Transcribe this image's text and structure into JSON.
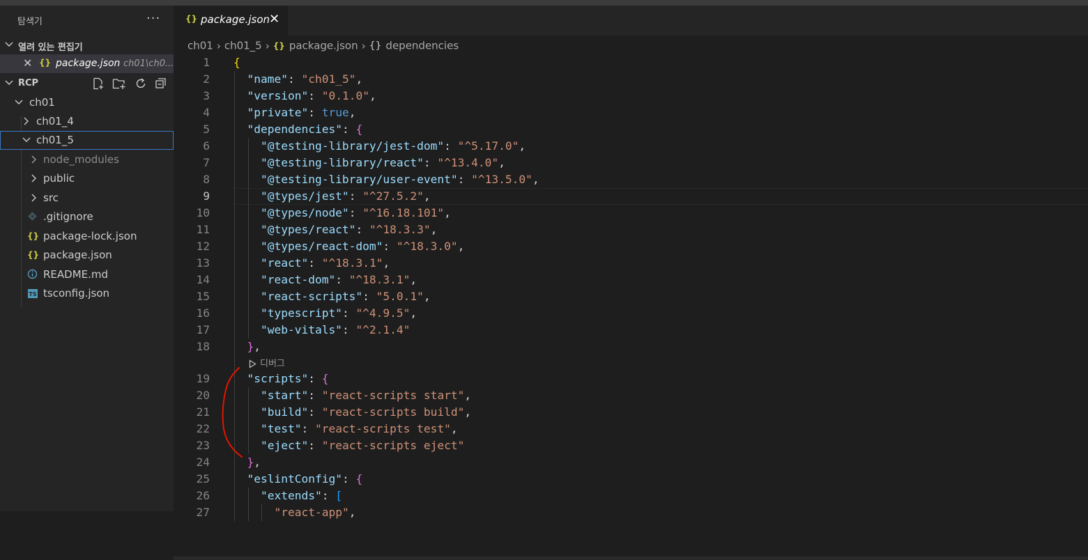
{
  "explorer": {
    "title": "탐색기",
    "more_label": "···",
    "open_editors": {
      "label": "열려 있는 편집기",
      "items": [
        {
          "icon": "{}",
          "name": "package.json",
          "path": "ch01\\ch0..."
        }
      ]
    },
    "workspace": {
      "label": "RCP",
      "tree": [
        {
          "label": "ch01",
          "type": "folder",
          "expanded": true
        },
        {
          "label": "ch01_4",
          "type": "folder",
          "expanded": false
        },
        {
          "label": "ch01_5",
          "type": "folder",
          "expanded": true,
          "selected": true
        },
        {
          "label": "node_modules",
          "type": "folder",
          "expanded": false
        },
        {
          "label": "public",
          "type": "folder",
          "expanded": false
        },
        {
          "label": "src",
          "type": "folder",
          "expanded": false
        },
        {
          "label": ".gitignore",
          "type": "file",
          "icon": "git-icon"
        },
        {
          "label": "package-lock.json",
          "type": "file",
          "icon": "{}"
        },
        {
          "label": "package.json",
          "type": "file",
          "icon": "{}"
        },
        {
          "label": "README.md",
          "type": "file",
          "icon": "info-icon"
        },
        {
          "label": "tsconfig.json",
          "type": "file",
          "icon": "TS"
        }
      ]
    }
  },
  "editor": {
    "tab": {
      "icon": "{}",
      "name": "package.json",
      "close": "✕"
    },
    "breadcrumb": [
      "ch01",
      "ch01_5",
      "package.json",
      "dependencies"
    ],
    "codelens_label": "디버그",
    "active_line": 9,
    "lines": [
      "{",
      "  \"name\": \"ch01_5\",",
      "  \"version\": \"0.1.0\",",
      "  \"private\": true,",
      "  \"dependencies\": {",
      "    \"@testing-library/jest-dom\": \"^5.17.0\",",
      "    \"@testing-library/react\": \"^13.4.0\",",
      "    \"@testing-library/user-event\": \"^13.5.0\",",
      "    \"@types/jest\": \"^27.5.2\",",
      "    \"@types/node\": \"^16.18.101\",",
      "    \"@types/react\": \"^18.3.3\",",
      "    \"@types/react-dom\": \"^18.3.0\",",
      "    \"react\": \"^18.3.1\",",
      "    \"react-dom\": \"^18.3.1\",",
      "    \"react-scripts\": \"5.0.1\",",
      "    \"typescript\": \"^4.9.5\",",
      "    \"web-vitals\": \"^2.1.4\"",
      "  },",
      "  \"scripts\": {",
      "    \"start\": \"react-scripts start\",",
      "    \"build\": \"react-scripts build\",",
      "    \"test\": \"react-scripts test\",",
      "    \"eject\": \"react-scripts eject\"",
      "  },",
      "  \"eslintConfig\": {",
      "    \"extends\": [",
      "      \"react-app\","
    ]
  },
  "colors": {
    "json_icon": "#cbcb41",
    "key": "#9cdcfe",
    "string": "#ce9178",
    "annotation": "#e51400"
  }
}
